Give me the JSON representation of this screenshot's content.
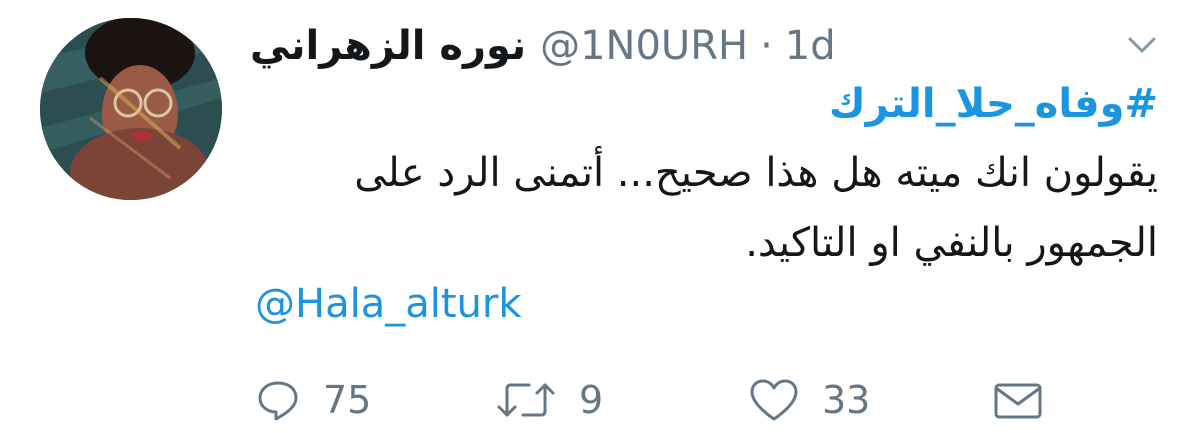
{
  "tweet": {
    "display_name": "نوره الزهراني",
    "handle": "@1N0URH",
    "separator": "·",
    "time": "1d",
    "hashtag": "#وفاه_حلا_الترك",
    "body_line1": "يقولون انك ميته هل هذا صحيح... أتمنى الرد على",
    "body_line2": "الجمهور بالنفي او التاكيد.",
    "mention": "@Hala_alturk"
  },
  "actions": {
    "replies": "75",
    "retweets": "9",
    "likes": "33"
  },
  "icons": {
    "menu": "chevron-down-icon",
    "reply": "speech-bubble-icon",
    "retweet": "retweet-arrows-icon",
    "like": "heart-icon",
    "dm": "envelope-icon"
  },
  "colors": {
    "link": "#1b95e0",
    "muted": "#657786",
    "text": "#14171a"
  }
}
